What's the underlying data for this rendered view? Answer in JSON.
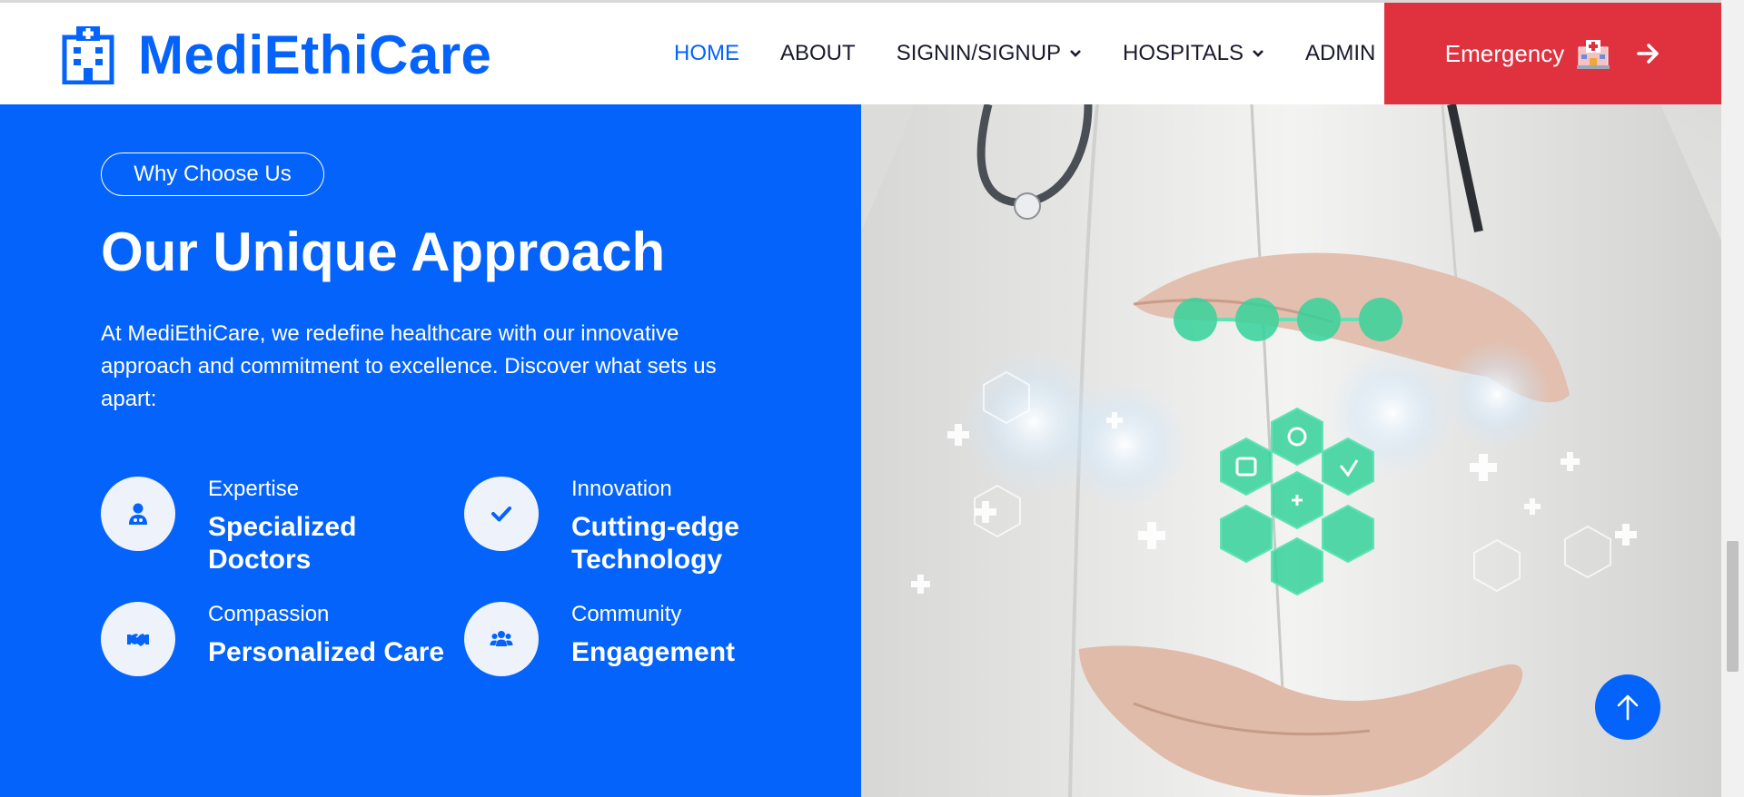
{
  "brand": {
    "name": "MediEthiCare",
    "icon": "hospital-building-icon",
    "color": "#0463fa"
  },
  "nav": {
    "items": [
      {
        "label": "HOME",
        "active": true
      },
      {
        "label": "ABOUT"
      },
      {
        "label": "SIGNIN/SIGNUP",
        "dropdown": true
      },
      {
        "label": "HOSPITALS",
        "dropdown": true
      },
      {
        "label": "ADMIN"
      }
    ],
    "emergency": {
      "label": "Emergency",
      "icon": "hospital-icon",
      "arrow_icon": "arrow-right-icon",
      "color": "#e0313f"
    }
  },
  "section": {
    "badge": "Why Choose Us",
    "heading": "Our Unique Approach",
    "description": "At MediEthiCare, we redefine healthcare with our innovative approach and commitment to excellence. Discover what sets us apart:",
    "background_color": "#0463fa",
    "features": [
      {
        "category": "Expertise",
        "title": "Specialized Doctors",
        "icon": "user-doctor-icon"
      },
      {
        "category": "Innovation",
        "title": "Cutting-edge Technology",
        "icon": "check-icon"
      },
      {
        "category": "Compassion",
        "title": "Personalized Care",
        "icon": "handshake-icon"
      },
      {
        "category": "Community",
        "title": "Engagement",
        "icon": "users-icon"
      }
    ]
  },
  "image": {
    "subject": "doctor-hands-medical-hexagon-icons"
  },
  "back_to_top": {
    "icon": "arrow-up-icon"
  }
}
